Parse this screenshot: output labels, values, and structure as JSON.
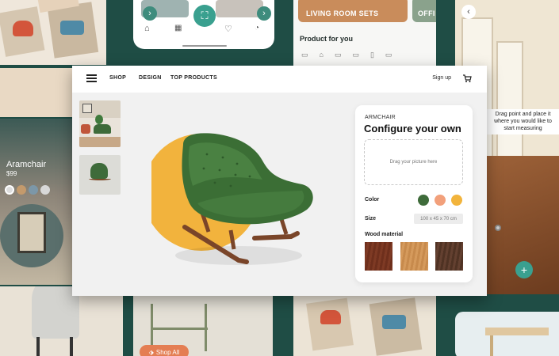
{
  "header": {
    "menu_icon": "hamburger-icon",
    "nav": [
      "SHOP",
      "DESIGN",
      "TOP PRODUCTS"
    ],
    "signup": "Sign up",
    "cart_icon": "cart-icon"
  },
  "configurator": {
    "category": "ARMCHAIR",
    "title": "Configure your own",
    "upload_hint": "Drag your picture here",
    "color_label": "Color",
    "colors": [
      "#3e6b3a",
      "#f2a07b",
      "#f2b43c"
    ],
    "size_label": "Size",
    "size_value": "100 x 45 x 70 cm",
    "wood_label": "Wood material",
    "woods": [
      "#6e2f1c",
      "#c78a4c",
      "#5a3a28"
    ]
  },
  "background": {
    "banner_living": "LIVING ROOM SETS",
    "banner_office": "OFFI",
    "section_title": "Product for you",
    "product_name": "Aramchair",
    "product_price": "$99",
    "ar_hint": "Drag point and place it where you would like to start measuring",
    "shop_all": "Shop All",
    "accent": "#1f4d45"
  }
}
